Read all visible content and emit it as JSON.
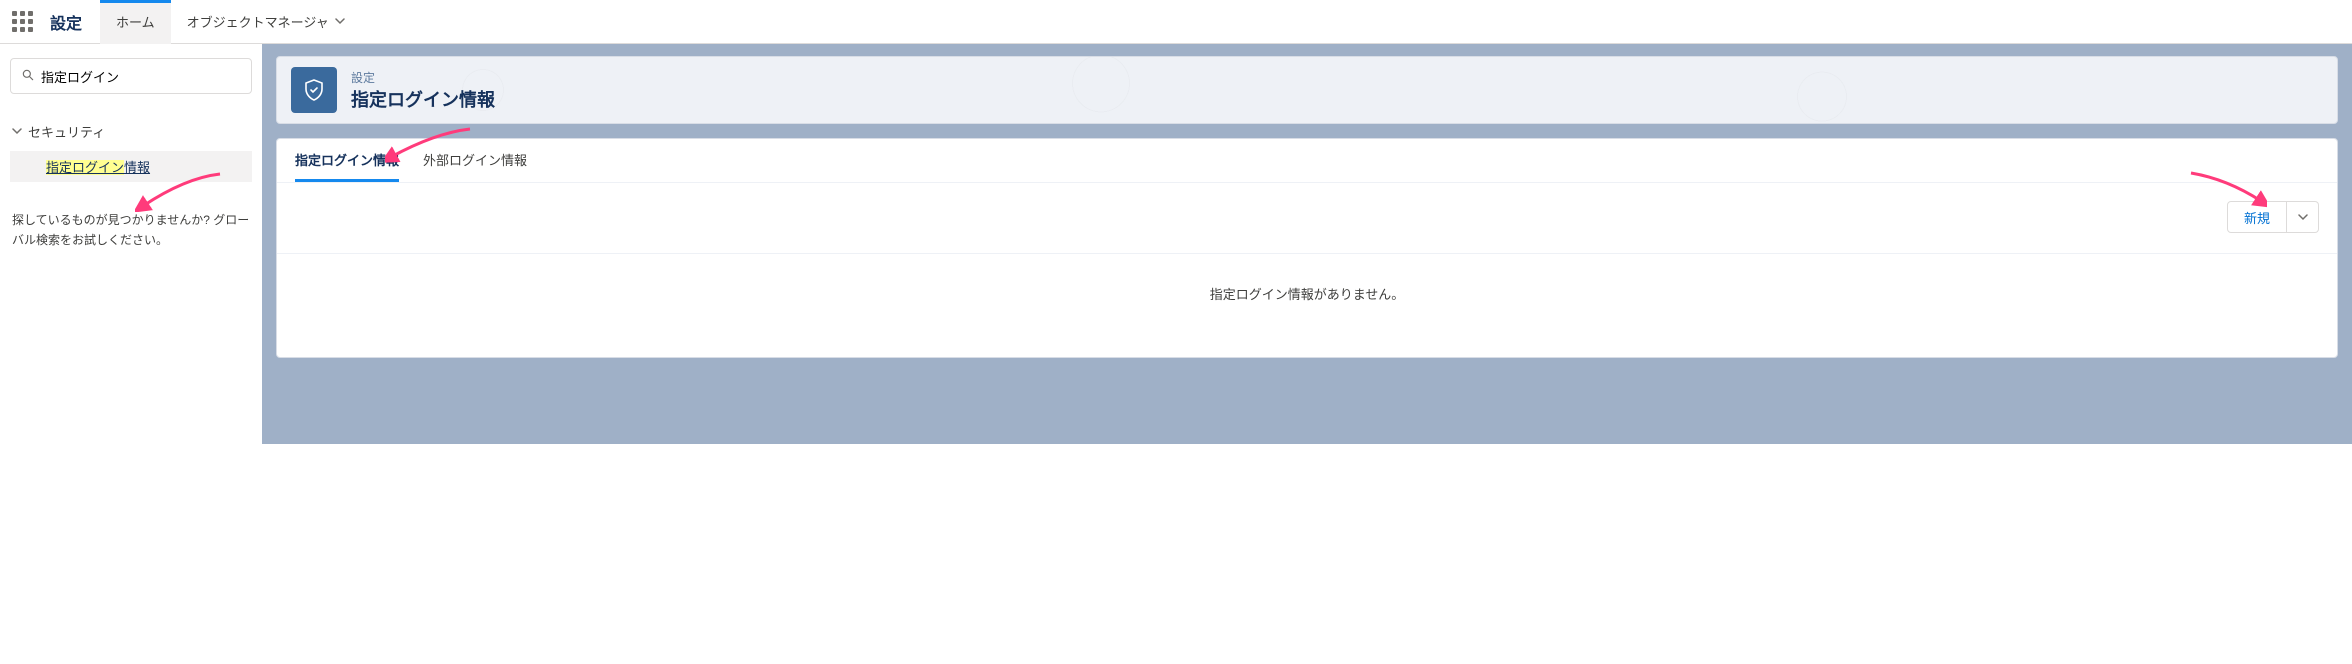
{
  "topbar": {
    "app_name": "設定",
    "tabs": [
      {
        "label": "ホーム",
        "active": true
      },
      {
        "label": "オブジェクトマネージャ",
        "active": false,
        "dropdown": true
      }
    ]
  },
  "sidebar": {
    "search_value": "指定ログイン",
    "tree": {
      "parent_label": "セキュリティ",
      "child_label_hl": "指定ログイン",
      "child_label_rest": "情報"
    },
    "help_text": "探しているものが見つかりませんか? グローバル検索をお試しください。"
  },
  "header": {
    "crumb": "設定",
    "title": "指定ログイン情報"
  },
  "panel": {
    "tabs": [
      {
        "label": "指定ログイン情報",
        "active": true
      },
      {
        "label": "外部ログイン情報",
        "active": false
      }
    ],
    "new_button": "新規",
    "empty_text": "指定ログイン情報がありません。"
  }
}
